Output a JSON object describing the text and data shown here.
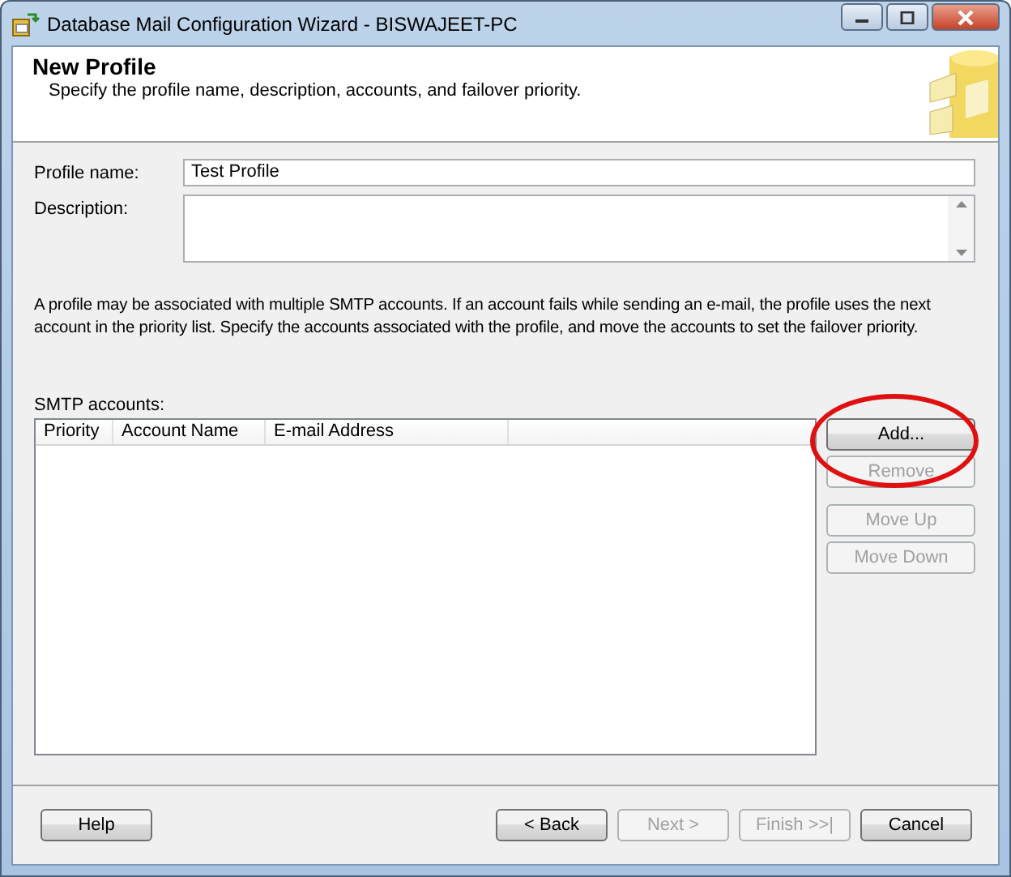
{
  "window": {
    "title": "Database Mail Configuration Wizard - BISWAJEET-PC"
  },
  "header": {
    "title": "New Profile",
    "subtitle": "Specify the profile name, description, accounts, and failover priority."
  },
  "form": {
    "profile_name": {
      "label": "Profile name:",
      "value": "Test Profile"
    },
    "description": {
      "label": "Description:"
    }
  },
  "info_text": "A profile may be associated with multiple SMTP accounts. If an account fails while sending an e-mail, the profile uses the next account in the priority list. Specify the accounts associated with the profile, and move the accounts to set the failover priority.",
  "smtp_accounts": {
    "label": "SMTP accounts:",
    "columns": [
      "Priority",
      "Account Name",
      "E-mail Address"
    ],
    "buttons": [
      {
        "label": "Add...",
        "disabled": false,
        "highlighted": true
      },
      {
        "label": "Remove",
        "disabled": true,
        "highlighted": false
      },
      {
        "label": "Move Up",
        "disabled": true,
        "highlighted": false
      },
      {
        "label": "Move Down",
        "disabled": true,
        "highlighted": false
      }
    ]
  },
  "footer": {
    "help": {
      "label": "Help",
      "disabled": false
    },
    "buttons": [
      {
        "label": "< Back",
        "disabled": false
      },
      {
        "label": "Next >",
        "disabled": true
      },
      {
        "label": "Finish >>|",
        "disabled": true
      },
      {
        "label": "Cancel",
        "disabled": false
      }
    ]
  }
}
